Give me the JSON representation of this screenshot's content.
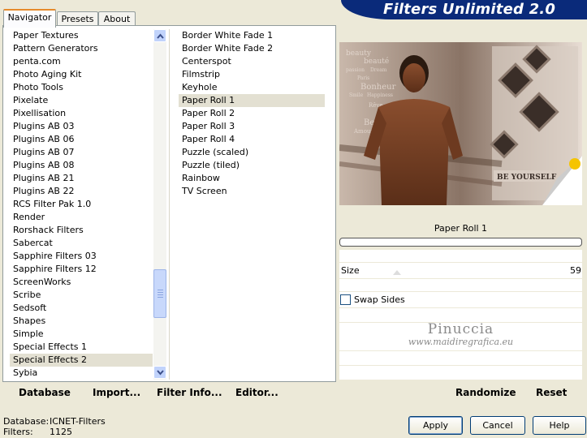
{
  "banner": {
    "title": "Filters Unlimited 2.0"
  },
  "tabs": [
    {
      "label": "Navigator",
      "active": true
    },
    {
      "label": "Presets",
      "active": false
    },
    {
      "label": "About",
      "active": false
    }
  ],
  "categories": {
    "items": [
      "Paper Textures",
      "Pattern Generators",
      "penta.com",
      "Photo Aging Kit",
      "Photo Tools",
      "Pixelate",
      "Pixellisation",
      "Plugins AB 03",
      "Plugins AB 06",
      "Plugins AB 07",
      "Plugins AB 08",
      "Plugins AB 21",
      "Plugins AB 22",
      "RCS Filter Pak 1.0",
      "Render",
      "Rorshack Filters",
      "Sabercat",
      "Sapphire Filters 03",
      "Sapphire Filters 12",
      "ScreenWorks",
      "Scribe",
      "Sedsoft",
      "Shapes",
      "Simple",
      "Special Effects 1",
      "Special Effects 2",
      "Sybia"
    ],
    "selected": "Special Effects 2"
  },
  "filters": {
    "items": [
      "Border White Fade 1",
      "Border White Fade 2",
      "Centerspot",
      "Filmstrip",
      "Keyhole",
      "Paper Roll 1",
      "Paper Roll 2",
      "Paper Roll 3",
      "Paper Roll 4",
      "Puzzle (scaled)",
      "Puzzle (tiled)",
      "Rainbow",
      "TV Screen"
    ],
    "selected": "Paper Roll 1"
  },
  "left_buttons": {
    "database": "Database",
    "import": "Import...",
    "filter_info": "Filter Info...",
    "editor": "Editor..."
  },
  "preview": {
    "filter_name": "Paper Roll 1",
    "progress_fraction": 0,
    "image_text": [
      "beauty",
      "beauté",
      "passion",
      "Dream",
      "Paris",
      "Bonheur",
      "Smile",
      "Happiness",
      "Rêve",
      "Be",
      "Amour"
    ],
    "badge": "BE YOURSELF"
  },
  "controls": {
    "size_label": "Size",
    "size_value": "59",
    "swap_label": "Swap Sides",
    "swap_checked": false
  },
  "watermark": {
    "name": "Pinuccia",
    "url": "www.maidiregrafica.eu"
  },
  "right_buttons": {
    "randomize": "Randomize",
    "reset": "Reset"
  },
  "status": {
    "database_label": "Database:",
    "database_value": "ICNET-Filters",
    "filters_label": "Filters:",
    "filters_value": "1125"
  },
  "dialog_buttons": {
    "apply": "Apply",
    "cancel": "Cancel",
    "help": "Help"
  },
  "colors": {
    "banner": "#0a2a7a",
    "face": "#ece9d8",
    "tab_accent": "#e68b2c",
    "selection": "#e3e0d2"
  }
}
